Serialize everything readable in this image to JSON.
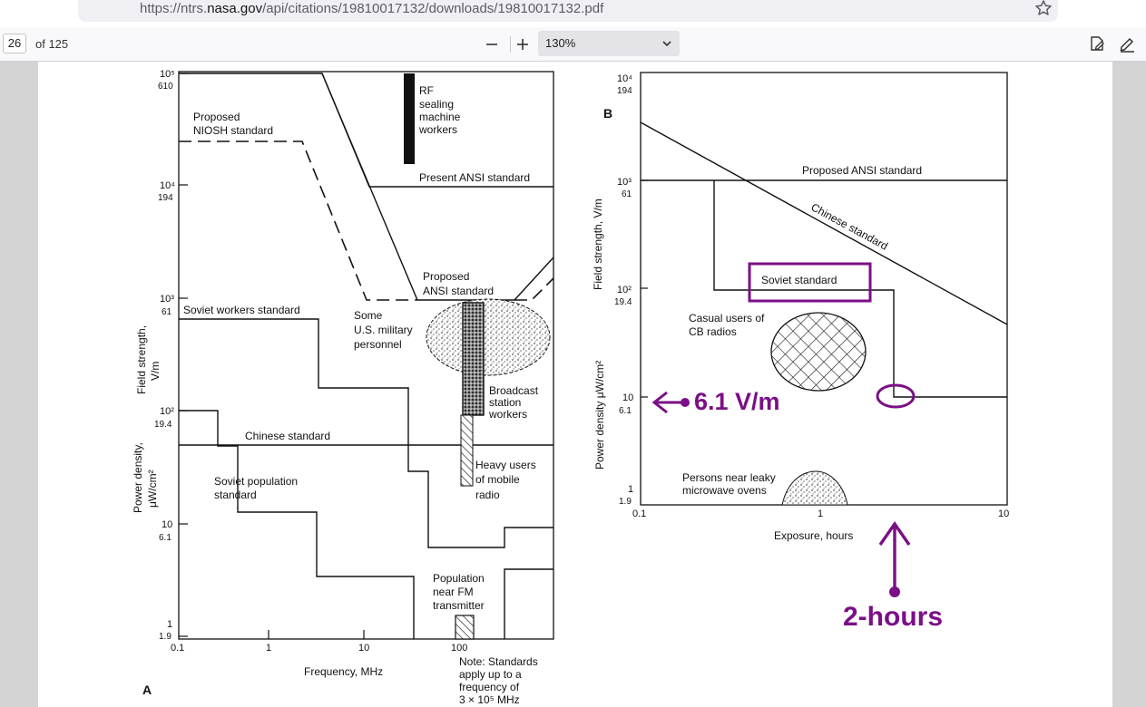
{
  "browser": {
    "url_prefix": "https://ntrs.",
    "url_domain": "nasa.gov",
    "url_suffix": "/api/citations/19810017132/downloads/19810017132.pdf"
  },
  "pdf_toolbar": {
    "page_number": "26",
    "page_count": "of 125",
    "zoom": "130%"
  },
  "figure_a": {
    "panel_label": "A",
    "y_ticks_top": [
      "10⁵",
      "10⁴",
      "10³",
      "10²",
      "10",
      "1"
    ],
    "y_ticks_bottom": [
      "610",
      "194",
      "61",
      "19.4",
      "6.1",
      "1.9"
    ],
    "x_ticks": [
      "0.1",
      "1",
      "10",
      "100"
    ],
    "ylabel_field": "Field strength,",
    "ylabel_field2": "V/m",
    "ylabel_power": "Power density,",
    "ylabel_power2": "μW/cm²",
    "xlabel": "Frequency, MHz",
    "labels": {
      "niosh1": "Proposed",
      "niosh2": "NIOSH standard",
      "rf1": "RF",
      "rf2": "sealing",
      "rf3": "machine",
      "rf4": "workers",
      "present_ansi": "Present ANSI standard",
      "prop_ansi1": "Proposed",
      "prop_ansi2": "ANSI standard",
      "soviet_workers": "Soviet workers standard",
      "military1": "Some",
      "military2": "U.S. military",
      "military3": "personnel",
      "broadcast1": "Broadcast",
      "broadcast2": "station",
      "broadcast3": "workers",
      "chinese": "Chinese standard",
      "heavy1": "Heavy users",
      "heavy2": "of mobile",
      "heavy3": "radio",
      "soviet_pop1": "Soviet population",
      "soviet_pop2": "standard",
      "fm1": "Population",
      "fm2": "near FM",
      "fm3": "transmitter",
      "note1": "Note: Standards",
      "note2": "apply up to a",
      "note3": "frequency of",
      "note4": "3 × 10⁵ MHz"
    }
  },
  "figure_b": {
    "panel_label": "B",
    "y_ticks_top": [
      "10⁴",
      "10³",
      "10²",
      "10",
      "1"
    ],
    "y_ticks_bottom": [
      "194",
      "61",
      "19.4",
      "6.1",
      "1.9"
    ],
    "x_ticks": [
      "0.1",
      "1",
      "10"
    ],
    "ylabel_field": "Field strength, V/m",
    "ylabel_power": "Power density  μW/cm²",
    "xlabel": "Exposure, hours",
    "labels": {
      "prop_ansi": "Proposed ANSI standard",
      "chinese": "Chinese standard",
      "soviet": "Soviet standard",
      "cb1": "Casual users of",
      "cb2": "CB radios",
      "oven1": "Persons near leaky",
      "oven2": "microwave ovens"
    }
  },
  "annotations": {
    "field_value": "6.1 V/m",
    "hours_value": "2-hours",
    "color": "#7b0f86"
  }
}
